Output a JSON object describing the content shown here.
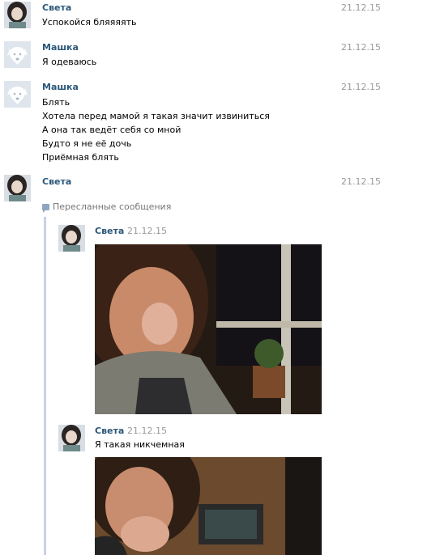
{
  "messages": [
    {
      "author": "Света",
      "date": "21.12.15",
      "lines": [
        "Успокойся бляяяять"
      ],
      "avatar": "sveta-avatar"
    },
    {
      "author": "Машка",
      "date": "21.12.15",
      "lines": [
        "Я одеваюсь"
      ],
      "avatar": "dog-avatar"
    },
    {
      "author": "Машка",
      "date": "21.12.15",
      "lines": [
        "Блять",
        "Хотела перед мамой я такая значит извиниться",
        "А она так ведёт себя со мной",
        "Будто я не её дочь",
        "Приёмная блять"
      ],
      "avatar": "dog-avatar"
    },
    {
      "author": "Света",
      "date": "21.12.15",
      "lines": [],
      "avatar": "sveta-avatar"
    }
  ],
  "forwarded": {
    "label": "Пересланные сообщения",
    "icon": "forward-message-icon",
    "items": [
      {
        "author": "Света",
        "date": "21.12.15",
        "text": "",
        "photo": "crying-girl-photo"
      },
      {
        "author": "Света",
        "date": "21.12.15",
        "text": "Я такая никчемная",
        "photo": "crying-girl-photo-2"
      }
    ]
  },
  "colors": {
    "author": "#2b587a",
    "date": "#999999",
    "forward_bar": "#c5d2e0"
  }
}
